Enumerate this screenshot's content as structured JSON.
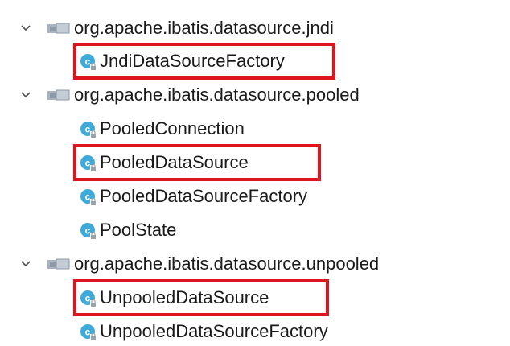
{
  "tree": {
    "packages": [
      {
        "name": "org.apache.ibatis.datasource.jndi",
        "expanded": true,
        "classes": [
          {
            "name": "JndiDataSourceFactory",
            "highlighted": true
          }
        ]
      },
      {
        "name": "org.apache.ibatis.datasource.pooled",
        "expanded": true,
        "classes": [
          {
            "name": "PooledConnection",
            "highlighted": false
          },
          {
            "name": "PooledDataSource",
            "highlighted": true
          },
          {
            "name": "PooledDataSourceFactory",
            "highlighted": false
          },
          {
            "name": "PoolState",
            "highlighted": false
          }
        ]
      },
      {
        "name": "org.apache.ibatis.datasource.unpooled",
        "expanded": true,
        "classes": [
          {
            "name": "UnpooledDataSource",
            "highlighted": true
          },
          {
            "name": "UnpooledDataSourceFactory",
            "highlighted": false
          }
        ]
      }
    ]
  },
  "colors": {
    "highlight": "#e0141e",
    "class_icon": "#3fa9d8",
    "package_icon": "#8e9aa8",
    "chevron": "#555555"
  },
  "icons": {
    "chevron": "chevron-down-icon",
    "package": "package-icon",
    "class": "class-icon"
  }
}
